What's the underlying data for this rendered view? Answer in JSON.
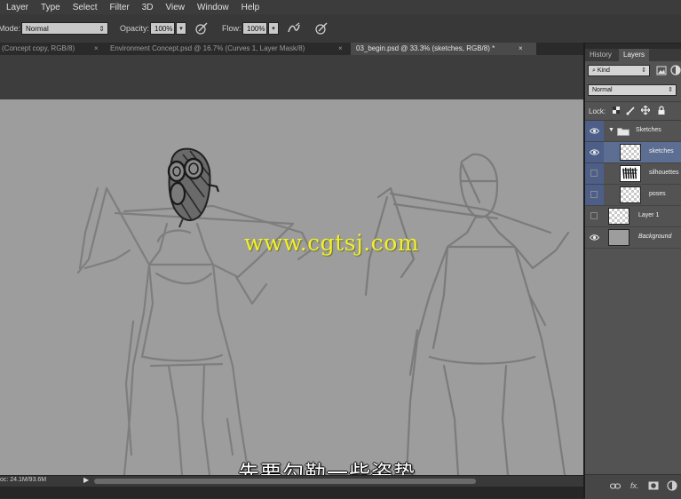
{
  "menu": [
    "Layer",
    "Type",
    "Select",
    "Filter",
    "3D",
    "View",
    "Window",
    "Help"
  ],
  "options": {
    "mode_label": "Mode:",
    "mode_value": "Normal",
    "opacity_label": "Opacity:",
    "opacity_value": "100%",
    "flow_label": "Flow:",
    "flow_value": "100%"
  },
  "tabs": [
    {
      "label": "(Concept copy, RGB/8)",
      "close": "×",
      "active": false
    },
    {
      "label": "Environment Concept.psd @ 16.7% (Curves 1, Layer Mask/8)",
      "close": "×",
      "active": false
    },
    {
      "label": "03_begin.psd @ 33.3% (sketches, RGB/8) *",
      "close": "×",
      "active": true
    }
  ],
  "canvas": {
    "watermark": "www.cgtsj.com",
    "subtitle": "先要勾勒一些姿势"
  },
  "status": {
    "doc_info": "oc: 24.1M/93.6M",
    "arrow": "▶"
  },
  "panel": {
    "tabs": [
      "History",
      "Layers"
    ],
    "active_tab": "Layers",
    "filter_label": "Kind",
    "blend_mode": "Normal",
    "lock_label": "Lock:",
    "layers": [
      {
        "name": "Sketches",
        "type": "group",
        "visible": true
      },
      {
        "name": "sketches",
        "visible": true,
        "selected": true
      },
      {
        "name": "silhouettes",
        "visible": false
      },
      {
        "name": "poses",
        "visible": false
      },
      {
        "name": "Layer 1",
        "visible": false
      },
      {
        "name": "Background",
        "visible": true
      }
    ],
    "footer_icons": [
      "link-icon",
      "fx-icon",
      "mask-icon",
      "adjustment-icon"
    ]
  },
  "colors": {
    "canvas_bg": "#9d9d9d",
    "selected_layer": "#5d6e93",
    "watermark": "#f0f030"
  }
}
